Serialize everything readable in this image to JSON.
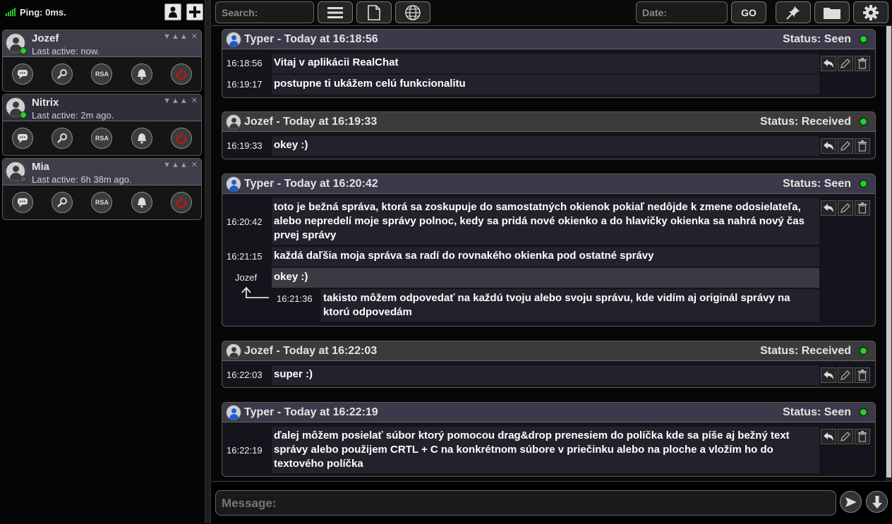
{
  "status": {
    "ping": "Ping: 0ms."
  },
  "contacts": [
    {
      "name": "Jozef",
      "last_active": "Last active: now.",
      "online": true
    },
    {
      "name": "Nitrix",
      "last_active": "Last active: 2m ago.",
      "online": true
    },
    {
      "name": "Mia",
      "last_active": "Last active: 6h 38m ago.",
      "online": false
    }
  ],
  "contact_actions": {
    "rsa": "RSA"
  },
  "toolbar": {
    "search_placeholder": "Search:",
    "date_placeholder": "Date:",
    "go_label": "GO"
  },
  "groups": [
    {
      "title": "Typer - Today at 16:18:56",
      "status": "Status: Seen",
      "messages": [
        {
          "time": "16:18:56",
          "text": "Vitaj v aplikácii RealChat"
        },
        {
          "time": "16:19:17",
          "text": "postupne ti ukážem celú funkcionalitu"
        }
      ]
    },
    {
      "title": "Jozef - Today at 16:19:33",
      "status": "Status: Received",
      "messages": [
        {
          "time": "16:19:33",
          "text": "okey :)"
        }
      ]
    },
    {
      "title": "Typer - Today at 16:20:42",
      "status": "Status: Seen",
      "messages": [
        {
          "time": "16:20:42",
          "text": "toto je bežná správa, ktorá sa zoskupuje do samostatných okienok pokiaľ nedôjde k zmene odosielateľa, alebo nepredelí moje správy polnoc, kedy sa pridá nové okienko a do hlavičky okienka sa nahrá nový čas prvej správy"
        },
        {
          "time": "16:21:15",
          "text": "každá daľšia moja správa sa radí do rovnakého okienka pod ostatné správy"
        }
      ],
      "reply": {
        "author": "Jozef",
        "quoted": "okey :)",
        "time": "16:21:36",
        "text": "takisto môžem odpovedať na každú tvoju alebo svoju správu, kde vidím aj originál správy na ktorú odpovedám"
      }
    },
    {
      "title": "Jozef - Today at 16:22:03",
      "status": "Status: Received",
      "messages": [
        {
          "time": "16:22:03",
          "text": "super :)"
        }
      ]
    },
    {
      "title": "Typer - Today at 16:22:19",
      "status": "Status: Seen",
      "messages": [
        {
          "time": "16:22:19",
          "text": "ďalej môžem posielať súbor ktorý pomocou drag&drop prenesiem do políčka kde sa píše aj bežný text správy alebo použijem CRTL + C na konkrétnom súbore v priečinku alebo na ploche a vložím ho do textového políčka"
        }
      ]
    }
  ],
  "composer": {
    "placeholder": "Message:"
  },
  "colors": {
    "online": "#22d322",
    "offline": "#555555",
    "typer_avatar": "#1e5bd6"
  }
}
